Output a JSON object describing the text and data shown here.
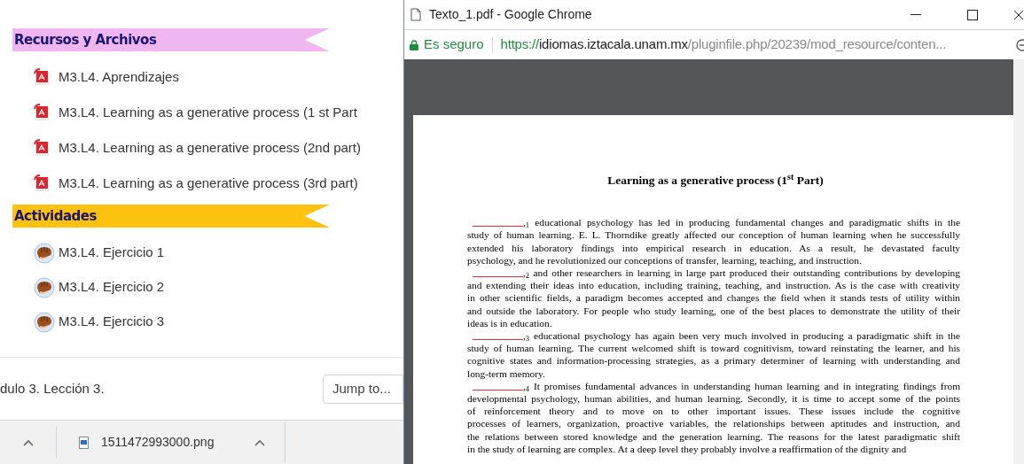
{
  "course_page": {
    "sections": [
      {
        "title": "Recursos y Archivos",
        "color": "#f0b6f0",
        "items": [
          {
            "label": "M3.L4. Aprendizajes",
            "kind": "pdf"
          },
          {
            "label": "M3.L4. Learning as a generative process (1 st Part",
            "kind": "pdf"
          },
          {
            "label": "M3.L4. Learning as a generative process (2nd part)",
            "kind": "pdf"
          },
          {
            "label": "M3.L4. Learning as a generative process (3rd part)",
            "kind": "pdf"
          }
        ]
      },
      {
        "title": "Actividades",
        "color": "#fcc20f",
        "items": [
          {
            "label": "M3.L4. Ejercicio 1",
            "kind": "activity"
          },
          {
            "label": "M3.L4. Ejercicio 2",
            "kind": "activity"
          },
          {
            "label": "M3.L4. Ejercicio 3",
            "kind": "activity"
          }
        ]
      }
    ],
    "footer_text": "dulo 3. Lección 3.",
    "jump_button": "Jump to..."
  },
  "downloads": {
    "items": [
      {
        "filename": "1511472993000.png"
      }
    ]
  },
  "browser_window": {
    "title": "Texto_1.pdf - Google Chrome",
    "security_label": "Es seguro",
    "url_scheme": "https://",
    "url_host": "idiomas.iztacala.unam.mx",
    "url_path": "/pluginfile.php/20239/mod_resource/conten...",
    "pdf": {
      "title": "Learning as a generative process (1$^{st}$ Part)",
      "paragraphs": [
        {
          "lines": [
            ",$_{1}$ educational psychology has led in producing fundamental changes and paradigmatic shifts in the",
            "study of human learning. E. L. Thorndike greatly affected our conception of human learning when he successfully",
            "extended his laboratory findings into empirical research in education. As a result, he devastated faculty",
            "psychology, and he revolutionized our conceptions of transfer, learning, teaching, and instruction."
          ]
        },
        {
          "lines": [
            ",$_{2}$ and other researchers in learning in large part produced their outstanding contributions by developing",
            "and extending their ideas into education, including training, teaching, and instruction. As is the case with creativity",
            "in other scientific fields, a paradigm becomes accepted and changes the field when it stands tests of utility within",
            "and outside the laboratory. For people who study learning, one of the best places to demonstrate the utility of their",
            "ideas is in education."
          ]
        },
        {
          "lines": [
            ",$_{3}$ educational psychology has again been very much involved in producing a paradigmatic shift in the",
            "study of human learning. The current welcomed shift is toward cognitivism, toward reinstating the learner, and his",
            "cognitive states and information-processing strategies, as a primary determiner of learning with understanding and",
            "long-term memory."
          ]
        },
        {
          "lines": [
            ",$_{4}$ It promises fundamental advances in understanding human learning and in integrating findings from",
            "developmental psychology, human abilities, and human learning. Secondly, it is time to accept some of the points",
            "of reinforcement theory and to move on to other important issues. These issues include the cognitive",
            "processes of learners, organization, proactive variables, the relationships between aptitudes and instruction, and",
            "the relations between stored knowledge and the generation learning. The reasons for the latest paradigmatic shift",
            "in the study of learning are complex. At a deep level they probably involve a reaffirmation of the dignity and"
          ]
        }
      ]
    }
  }
}
